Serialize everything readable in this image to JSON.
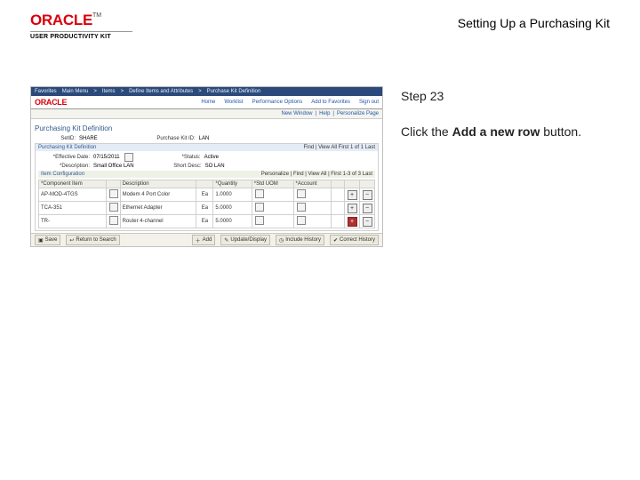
{
  "doc": {
    "title": "Setting Up a Purchasing Kit",
    "logo_sub": "USER PRODUCTIVITY KIT"
  },
  "instr": {
    "step": "Step 23",
    "line1a": "Click the ",
    "line1b": "Add a new row",
    "line1c": " button."
  },
  "ss": {
    "nav": {
      "a": "Favorites",
      "b": "Main Menu",
      "c": "Items",
      "d": "Define Items and Attributes",
      "e": "Purchase Kit Definition"
    },
    "brand": "ORACLE",
    "topLinks": {
      "home": "Home",
      "worklist": "Worklist",
      "perf": "Performance Options",
      "add": "Add to Favorites",
      "signout": "Sign out"
    },
    "subbar": {
      "win": "New Window",
      "help": "Help",
      "pers": "Personalize Page"
    },
    "pageTitle": "Purchasing Kit Definition",
    "head": {
      "setid_l": "SetID:",
      "setid_v": "SHARE",
      "pkit_l": "Purchase Kit ID:",
      "pkit_v": "LAN"
    },
    "sect1": {
      "title": "Purchasing Kit Definition",
      "nav": "Find | View All   First  1 of 1  Last",
      "eff_l": "*Effective Date:",
      "eff_v": "07/15/2011",
      "stat_l": "*Status:",
      "stat_v": "Active",
      "desc_l": "*Description:",
      "desc_v": "Small Office LAN",
      "short_l": "Short Desc:",
      "short_v": "SO LAN"
    },
    "sect2": {
      "title": "Item Configuration",
      "nav": "Personalize | Find | View All |      First  1-3 of 3  Last",
      "headers": [
        "*Component Item",
        "",
        "Description",
        "",
        "*Quantity",
        "*Std UOM",
        "*Account",
        ""
      ],
      "rows": [
        {
          "item": "AP-MOD-4TGS",
          "desc": "Modem 4 Port Color",
          "acct": "Ea",
          "qty": "1.0000",
          "uom": "",
          "acc": ""
        },
        {
          "item": "TCA-351",
          "desc": "Ethernet Adapter",
          "acct": "Ea",
          "qty": "5.0000",
          "uom": "",
          "acc": ""
        },
        {
          "item": "TR-",
          "desc": "Router 4-channel",
          "acct": "Ea",
          "qty": "5.0000",
          "uom": "",
          "acc": ""
        }
      ]
    },
    "foot": {
      "save": "Save",
      "ret": "Return to Search",
      "add": "Add",
      "upd": "Update/Display",
      "hist": "Include History",
      "corr": "Correct History"
    }
  }
}
